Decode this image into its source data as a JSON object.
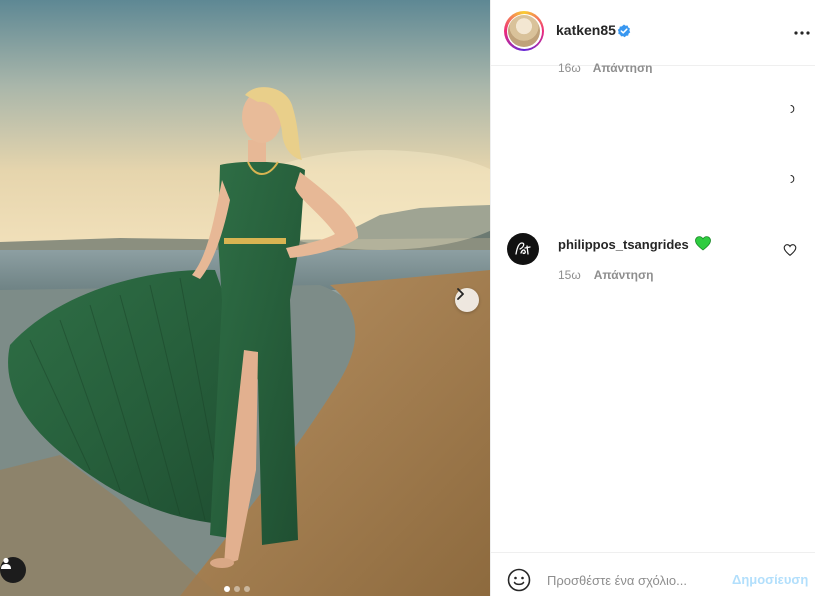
{
  "post": {
    "author": {
      "username": "katken85",
      "verified": true,
      "avatar_icon": "profile-photo"
    },
    "image": {
      "carousel_total": 3,
      "carousel_active": 1,
      "next_icon": "chevron-right-icon",
      "tag_icon": "user-icon"
    }
  },
  "partial_comment": {
    "time": "16ω",
    "reply_label": "Απάντηση"
  },
  "comments": [
    {
      "username": "philippos_tsangrides",
      "text_emoji": "green-heart-emoji",
      "time": "15ω",
      "reply_label": "Απάντηση",
      "like_icon": "heart-outline-icon"
    }
  ],
  "composer": {
    "placeholder": "Προσθέστε ένα σχόλιο...",
    "post_label": "Δημοσίευση",
    "emoji_icon": "smiley-icon"
  },
  "colors": {
    "verified": "#3897f0",
    "link_disabled": "#b2dffc",
    "meta_text": "#8e8e8e",
    "green_heart": "#2ecc40",
    "dress": "#2f6b45"
  }
}
